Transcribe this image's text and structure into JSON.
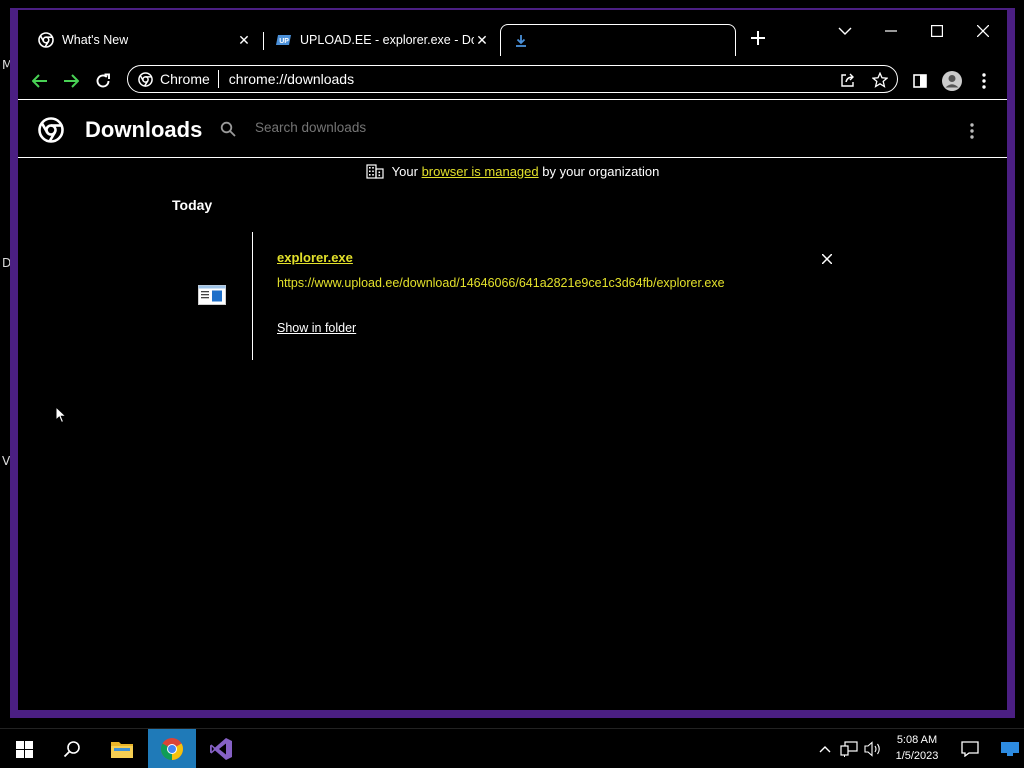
{
  "desktop": {
    "letters": [
      "M",
      "D",
      "V"
    ]
  },
  "browser": {
    "tabs": [
      {
        "title": "What's New",
        "favicon": "chrome-icon"
      },
      {
        "title": "UPLOAD.EE - explorer.exe - Dow",
        "favicon": "upload-ee-icon"
      },
      {
        "title": "",
        "favicon": "download-icon"
      }
    ],
    "omnibox": {
      "chip_label": "Chrome",
      "url": "chrome://downloads"
    }
  },
  "downloads": {
    "title": "Downloads",
    "search_placeholder": "Search downloads",
    "managed_prefix": "Your",
    "managed_link": "browser is managed",
    "managed_suffix": "by your organization",
    "date_group": "Today",
    "items": [
      {
        "file_name": "explorer.exe",
        "url": "https://www.upload.ee/download/14646066/641a2821e9ce1c3d64fb/explorer.exe",
        "action": "Show in folder"
      }
    ]
  },
  "taskbar": {
    "apps": [
      "start-icon",
      "search-icon",
      "file-explorer-icon",
      "chrome-icon",
      "visual-studio-icon"
    ],
    "active_app": "chrome-icon",
    "time": "5:08 AM",
    "date": "1/5/2023"
  },
  "colors": {
    "accent": "#e3e12b",
    "frame": "#4b1f83",
    "taskbar_active": "#1f7ab8"
  }
}
